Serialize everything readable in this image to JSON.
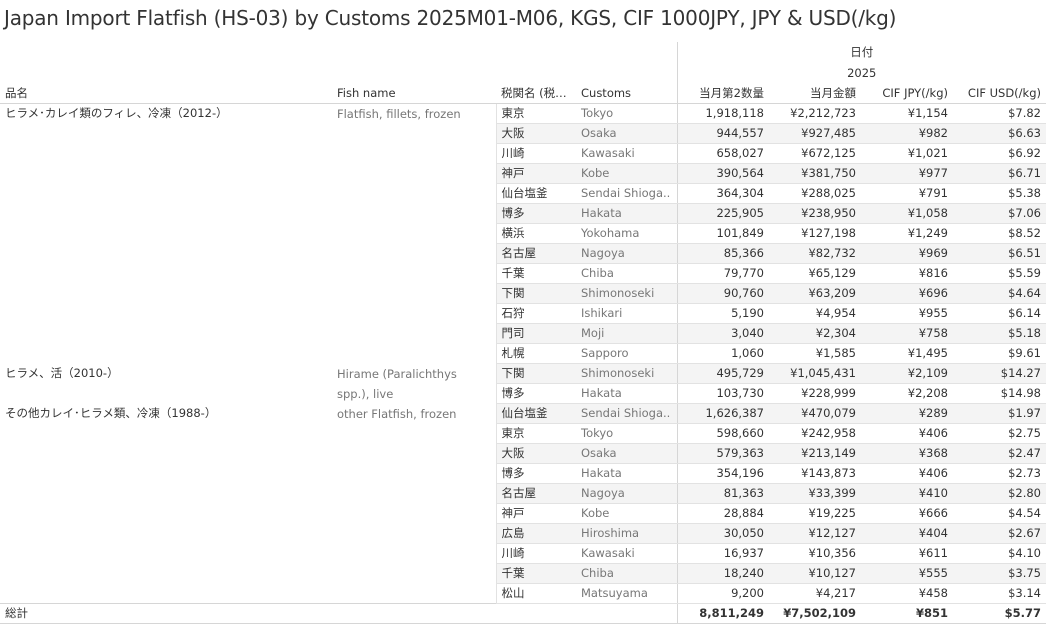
{
  "title": "Japan Import Flatfish (HS-03) by Customs 2025M01-M06, KGS, CIF 1000JPY, JPY & USD(/kg)",
  "header": {
    "date_group": "日付",
    "year": "2025",
    "col_item_jp": "品名",
    "col_fish_name": "Fish name",
    "col_customs_jp": "税関名 (税関..",
    "col_customs_en": "Customs",
    "col_qty": "当月第2数量",
    "col_value": "当月金額",
    "col_cif_jpy": "CIF JPY(/kg)",
    "col_cif_usd": "CIF USD(/kg)"
  },
  "chart_data": {
    "type": "table",
    "groups": [
      {
        "item_jp": "ヒラメ･カレイ類のフィレ、冷凍（2012-）",
        "fish_name": "Flatfish, fillets, frozen",
        "rows": [
          {
            "customs_jp": "東京",
            "customs_en": "Tokyo",
            "qty": "1,918,118",
            "value": "¥2,212,723",
            "cif_jpy": "¥1,154",
            "cif_usd": "$7.82"
          },
          {
            "customs_jp": "大阪",
            "customs_en": "Osaka",
            "qty": "944,557",
            "value": "¥927,485",
            "cif_jpy": "¥982",
            "cif_usd": "$6.63"
          },
          {
            "customs_jp": "川崎",
            "customs_en": "Kawasaki",
            "qty": "658,027",
            "value": "¥672,125",
            "cif_jpy": "¥1,021",
            "cif_usd": "$6.92"
          },
          {
            "customs_jp": "神戸",
            "customs_en": "Kobe",
            "qty": "390,564",
            "value": "¥381,750",
            "cif_jpy": "¥977",
            "cif_usd": "$6.71"
          },
          {
            "customs_jp": "仙台塩釜",
            "customs_en": "Sendai Shioga..",
            "qty": "364,304",
            "value": "¥288,025",
            "cif_jpy": "¥791",
            "cif_usd": "$5.38"
          },
          {
            "customs_jp": "博多",
            "customs_en": "Hakata",
            "qty": "225,905",
            "value": "¥238,950",
            "cif_jpy": "¥1,058",
            "cif_usd": "$7.06"
          },
          {
            "customs_jp": "横浜",
            "customs_en": "Yokohama",
            "qty": "101,849",
            "value": "¥127,198",
            "cif_jpy": "¥1,249",
            "cif_usd": "$8.52"
          },
          {
            "customs_jp": "名古屋",
            "customs_en": "Nagoya",
            "qty": "85,366",
            "value": "¥82,732",
            "cif_jpy": "¥969",
            "cif_usd": "$6.51"
          },
          {
            "customs_jp": "千葉",
            "customs_en": "Chiba",
            "qty": "79,770",
            "value": "¥65,129",
            "cif_jpy": "¥816",
            "cif_usd": "$5.59"
          },
          {
            "customs_jp": "下関",
            "customs_en": "Shimonoseki",
            "qty": "90,760",
            "value": "¥63,209",
            "cif_jpy": "¥696",
            "cif_usd": "$4.64"
          },
          {
            "customs_jp": "石狩",
            "customs_en": "Ishikari",
            "qty": "5,190",
            "value": "¥4,954",
            "cif_jpy": "¥955",
            "cif_usd": "$6.14"
          },
          {
            "customs_jp": "門司",
            "customs_en": "Moji",
            "qty": "3,040",
            "value": "¥2,304",
            "cif_jpy": "¥758",
            "cif_usd": "$5.18"
          },
          {
            "customs_jp": "札幌",
            "customs_en": "Sapporo",
            "qty": "1,060",
            "value": "¥1,585",
            "cif_jpy": "¥1,495",
            "cif_usd": "$9.61"
          }
        ]
      },
      {
        "item_jp": "ヒラメ、活（2010-）",
        "fish_name": "Hirame (Paralichthys spp.), live",
        "rows": [
          {
            "customs_jp": "下関",
            "customs_en": "Shimonoseki",
            "qty": "495,729",
            "value": "¥1,045,431",
            "cif_jpy": "¥2,109",
            "cif_usd": "$14.27"
          },
          {
            "customs_jp": "博多",
            "customs_en": "Hakata",
            "qty": "103,730",
            "value": "¥228,999",
            "cif_jpy": "¥2,208",
            "cif_usd": "$14.98"
          }
        ]
      },
      {
        "item_jp": "その他カレイ･ヒラメ類、冷凍（1988-）",
        "fish_name": "other Flatfish, frozen",
        "rows": [
          {
            "customs_jp": "仙台塩釜",
            "customs_en": "Sendai Shioga..",
            "qty": "1,626,387",
            "value": "¥470,079",
            "cif_jpy": "¥289",
            "cif_usd": "$1.97"
          },
          {
            "customs_jp": "東京",
            "customs_en": "Tokyo",
            "qty": "598,660",
            "value": "¥242,958",
            "cif_jpy": "¥406",
            "cif_usd": "$2.75"
          },
          {
            "customs_jp": "大阪",
            "customs_en": "Osaka",
            "qty": "579,363",
            "value": "¥213,149",
            "cif_jpy": "¥368",
            "cif_usd": "$2.47"
          },
          {
            "customs_jp": "博多",
            "customs_en": "Hakata",
            "qty": "354,196",
            "value": "¥143,873",
            "cif_jpy": "¥406",
            "cif_usd": "$2.73"
          },
          {
            "customs_jp": "名古屋",
            "customs_en": "Nagoya",
            "qty": "81,363",
            "value": "¥33,399",
            "cif_jpy": "¥410",
            "cif_usd": "$2.80"
          },
          {
            "customs_jp": "神戸",
            "customs_en": "Kobe",
            "qty": "28,884",
            "value": "¥19,225",
            "cif_jpy": "¥666",
            "cif_usd": "$4.54"
          },
          {
            "customs_jp": "広島",
            "customs_en": "Hiroshima",
            "qty": "30,050",
            "value": "¥12,127",
            "cif_jpy": "¥404",
            "cif_usd": "$2.67"
          },
          {
            "customs_jp": "川崎",
            "customs_en": "Kawasaki",
            "qty": "16,937",
            "value": "¥10,356",
            "cif_jpy": "¥611",
            "cif_usd": "$4.10"
          },
          {
            "customs_jp": "千葉",
            "customs_en": "Chiba",
            "qty": "18,240",
            "value": "¥10,127",
            "cif_jpy": "¥555",
            "cif_usd": "$3.75"
          },
          {
            "customs_jp": "松山",
            "customs_en": "Matsuyama",
            "qty": "9,200",
            "value": "¥4,217",
            "cif_jpy": "¥458",
            "cif_usd": "$3.14"
          }
        ]
      }
    ],
    "total": {
      "label": "総計",
      "qty": "8,811,249",
      "value": "¥7,502,109",
      "cif_jpy": "¥851",
      "cif_usd": "$5.77"
    }
  }
}
